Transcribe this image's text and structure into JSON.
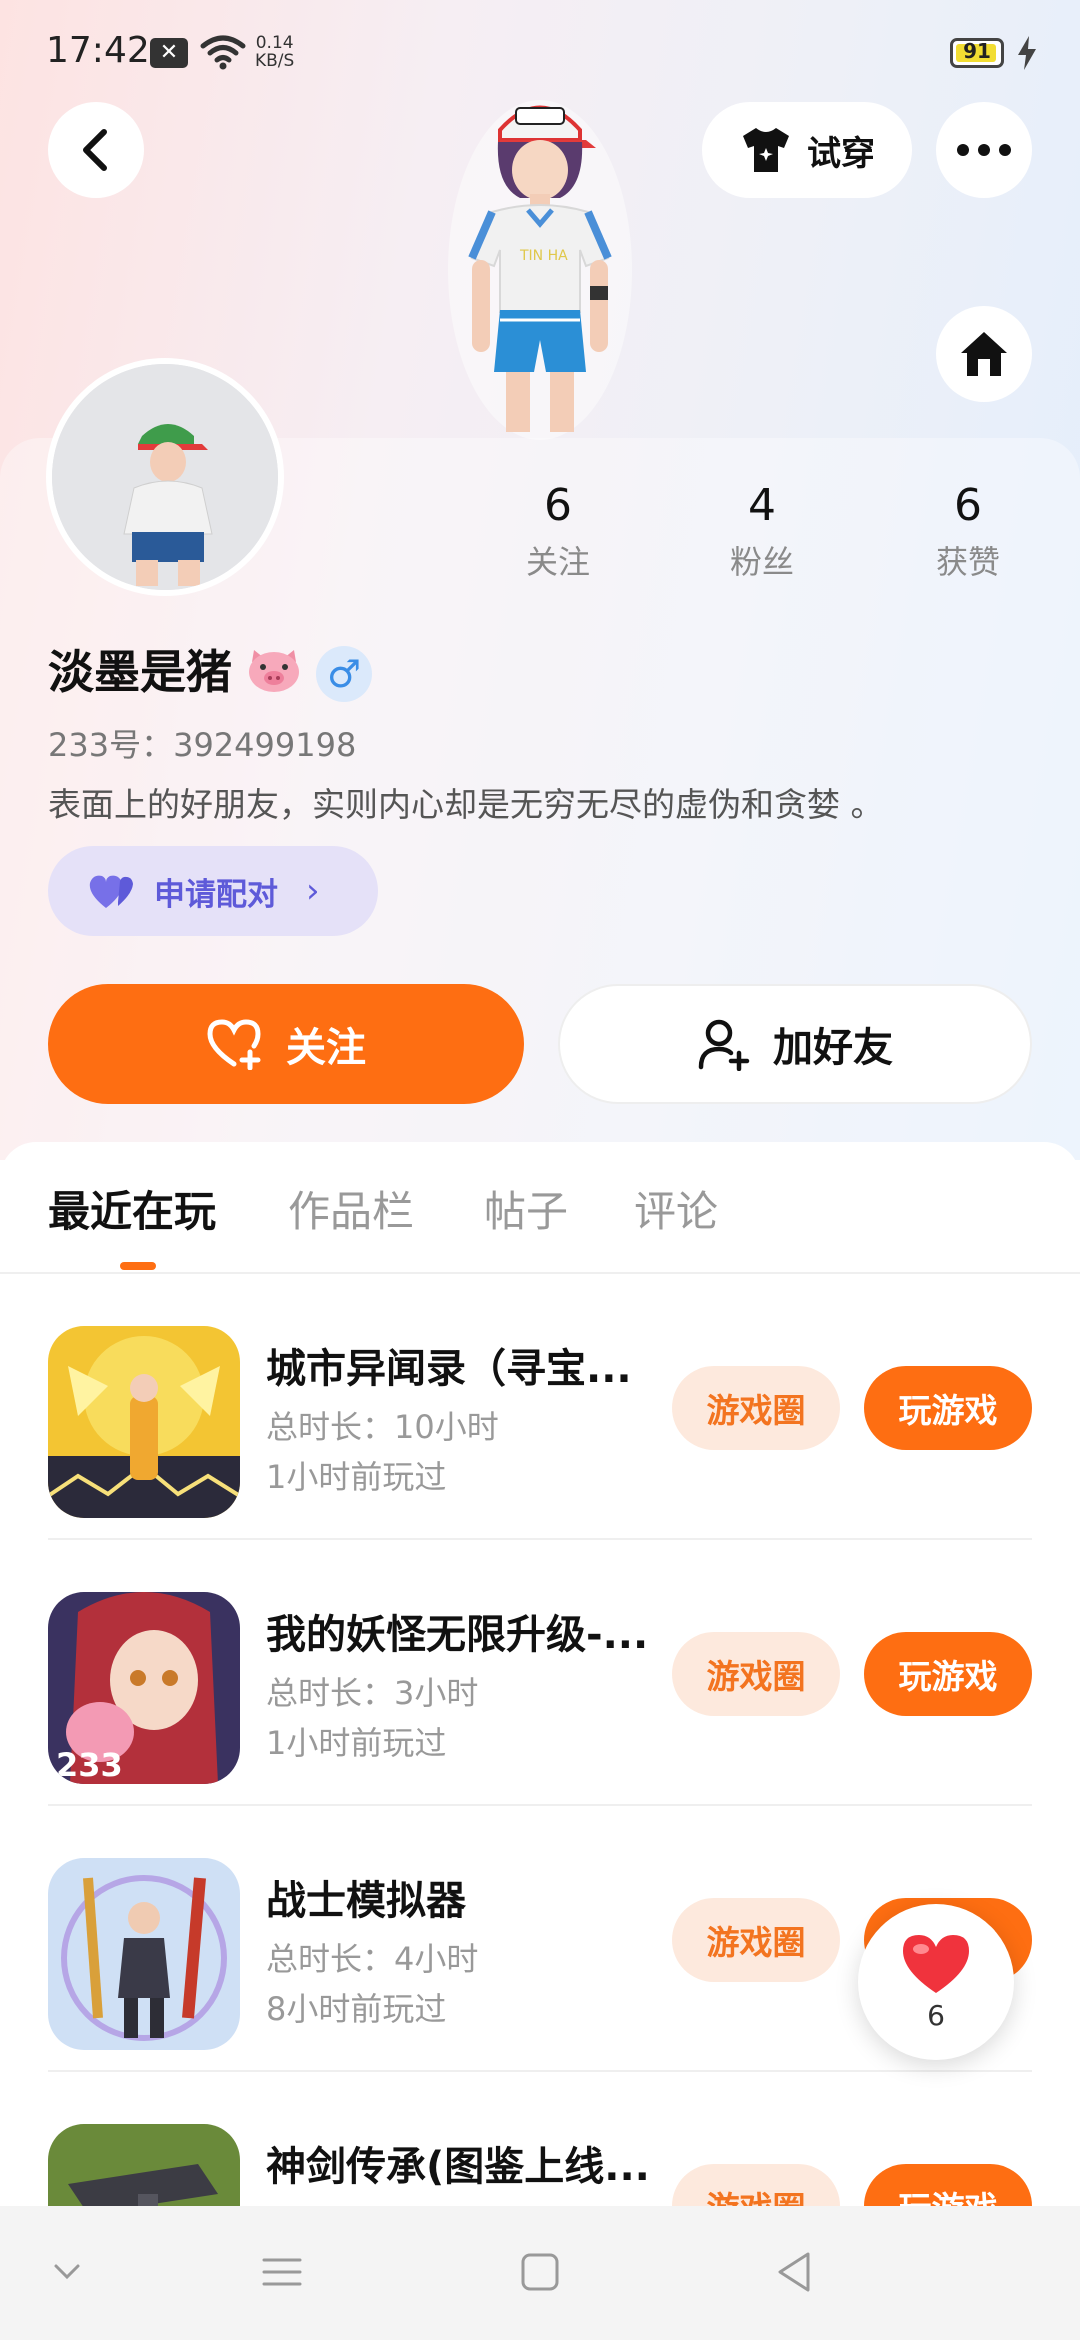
{
  "status_bar": {
    "time": "17:42",
    "net_speed_value": "0.14",
    "net_speed_unit": "KB/S",
    "battery": "91"
  },
  "header": {
    "tryon_label": "试穿"
  },
  "profile": {
    "nickname": "淡墨是猪",
    "gender_symbol": "♂",
    "uid": "233号：392499198",
    "bio": "表面上的好朋友，实则内心却是无穷无尽的虚伪和贪婪 。",
    "pair_label": "申请配对",
    "stats": [
      {
        "value": "6",
        "label": "关注"
      },
      {
        "value": "4",
        "label": "粉丝"
      },
      {
        "value": "6",
        "label": "获赞"
      }
    ]
  },
  "actions": {
    "follow_label": "关注",
    "add_friend_label": "加好友"
  },
  "tabs": [
    "最近在玩",
    "作品栏",
    "帖子",
    "评论"
  ],
  "games": [
    {
      "title": "城市异闻录（寻宝...",
      "duration": "总时长：10小时",
      "last_played": "1小时前玩过",
      "circle_label": "游戏圈",
      "play_label": "玩游戏"
    },
    {
      "title": "我的妖怪无限升级-...",
      "duration": "总时长：3小时",
      "last_played": "1小时前玩过",
      "circle_label": "游戏圈",
      "play_label": "玩游戏"
    },
    {
      "title": "战士模拟器",
      "duration": "总时长：4小时",
      "last_played": "8小时前玩过",
      "circle_label": "游戏圈",
      "play_label": "玩游戏"
    },
    {
      "title": "神剑传承(图鉴上线...",
      "duration": "",
      "last_played": "",
      "circle_label": "游戏圈",
      "play_label": "玩游戏"
    }
  ],
  "like_float": {
    "count": "6"
  },
  "colors": {
    "accent": "#fe6e12",
    "pair": "#5e5ad9",
    "gender": "#3a8de6"
  }
}
